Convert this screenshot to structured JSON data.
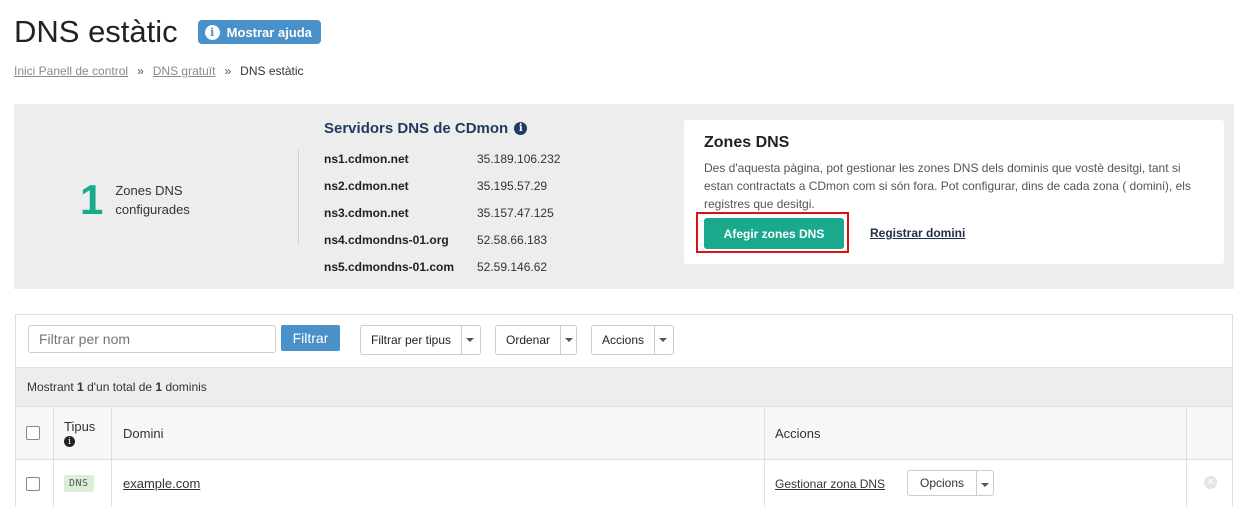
{
  "header": {
    "title": "DNS estàtic",
    "help_button": "Mostrar ajuda"
  },
  "breadcrumb": {
    "items": [
      "Inici Panell de control",
      "DNS gratuït",
      "DNS estàtic"
    ],
    "separator": "»"
  },
  "summary": {
    "count": "1",
    "count_label": "Zones DNS configurades",
    "servers_title": "Servidors DNS de CDmon",
    "servers": [
      {
        "name": "ns1.cdmon.net",
        "ip": "35.189.106.232"
      },
      {
        "name": "ns2.cdmon.net",
        "ip": "35.195.57.29"
      },
      {
        "name": "ns3.cdmon.net",
        "ip": "35.157.47.125"
      },
      {
        "name": "ns4.cdmondns-01.org",
        "ip": "52.58.66.183"
      },
      {
        "name": "ns5.cdmondns-01.com",
        "ip": "52.59.146.62"
      }
    ]
  },
  "zones_card": {
    "title": "Zones DNS",
    "description": "Des d'aquesta pàgina, pot gestionar les zones DNS dels dominis que vostè desitgi, tant si estan contractats a CDmon com si són fora. Pot configurar, dins de cada zona ( domini), els registres que desitgi.",
    "add_button": "Afegir zones DNS",
    "register_link": "Registrar domini"
  },
  "toolbar": {
    "filter_placeholder": "Filtrar per nom",
    "filter_button": "Filtrar",
    "filter_type": "Filtrar per tipus",
    "order": "Ordenar",
    "actions": "Accions"
  },
  "showing": {
    "prefix": "Mostrant",
    "shown": "1",
    "middle": "d'un total de",
    "total": "1",
    "suffix": "dominis"
  },
  "table": {
    "headers": {
      "type": "Tipus",
      "domain": "Domini",
      "actions": "Accions"
    },
    "rows": [
      {
        "type": "DNS",
        "domain": "example.com",
        "manage": "Gestionar zona DNS",
        "options": "Opcions"
      }
    ]
  },
  "colors": {
    "accent_teal": "#1aa98c",
    "accent_blue": "#4a90c9",
    "highlight_red": "#dd1111",
    "navy": "#1f3a5f"
  }
}
